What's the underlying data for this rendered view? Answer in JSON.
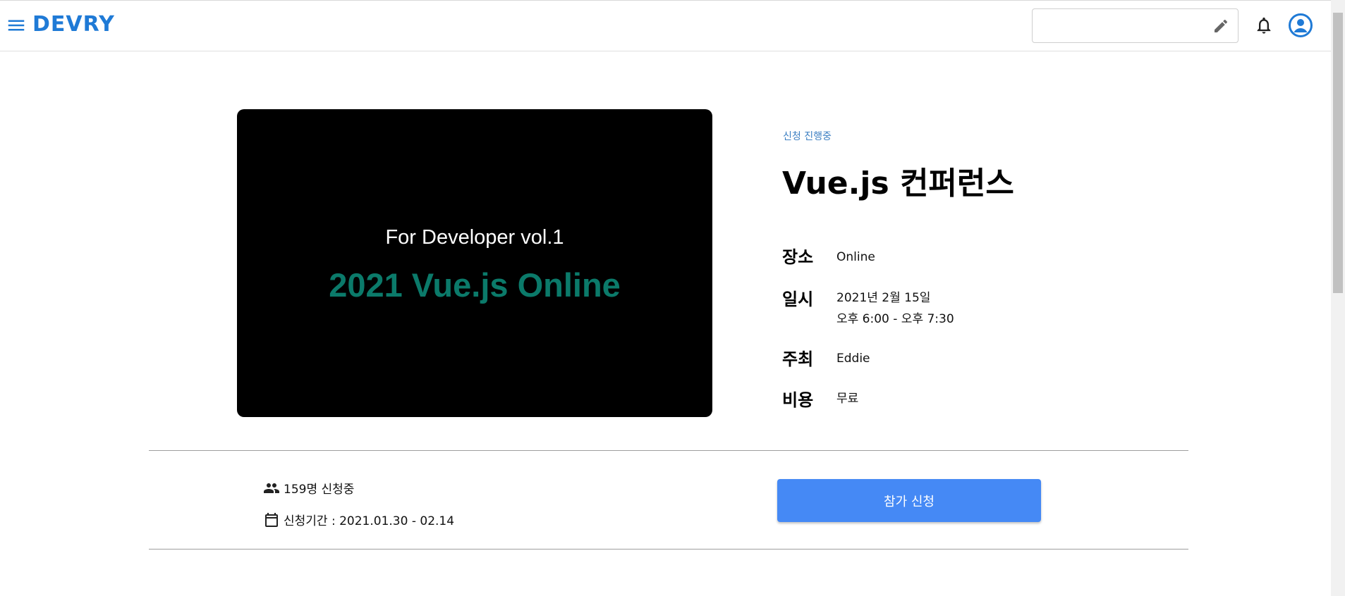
{
  "header": {
    "logo": "DEVRY",
    "search": {
      "value": "",
      "placeholder": ""
    }
  },
  "event": {
    "poster": {
      "subtitle": "For Developer vol.1",
      "title": "2021 Vue.js Online"
    },
    "status": "신청 진행중",
    "title": "Vue.js 컨퍼런스",
    "info": {
      "place_label": "장소",
      "place_value": "Online",
      "date_label": "일시",
      "date_line1": "2021년 2월 15일",
      "date_line2": "오후 6:00 - 오후 7:30",
      "host_label": "주최",
      "host_value": "Eddie",
      "cost_label": "비용",
      "cost_value": "무료"
    },
    "applicants": "159명 신청중",
    "period": "신청기간 : 2021.01.30 - 02.14",
    "apply_label": "참가 신청"
  },
  "colors": {
    "brand": "#1f7ad6",
    "accent": "#4589f5",
    "status": "#3c7fc2",
    "poster_title": "#0b7a6a"
  },
  "icons": [
    "menu-icon",
    "pencil-icon",
    "bell-icon",
    "account-circle-icon",
    "people-icon",
    "calendar-icon"
  ]
}
